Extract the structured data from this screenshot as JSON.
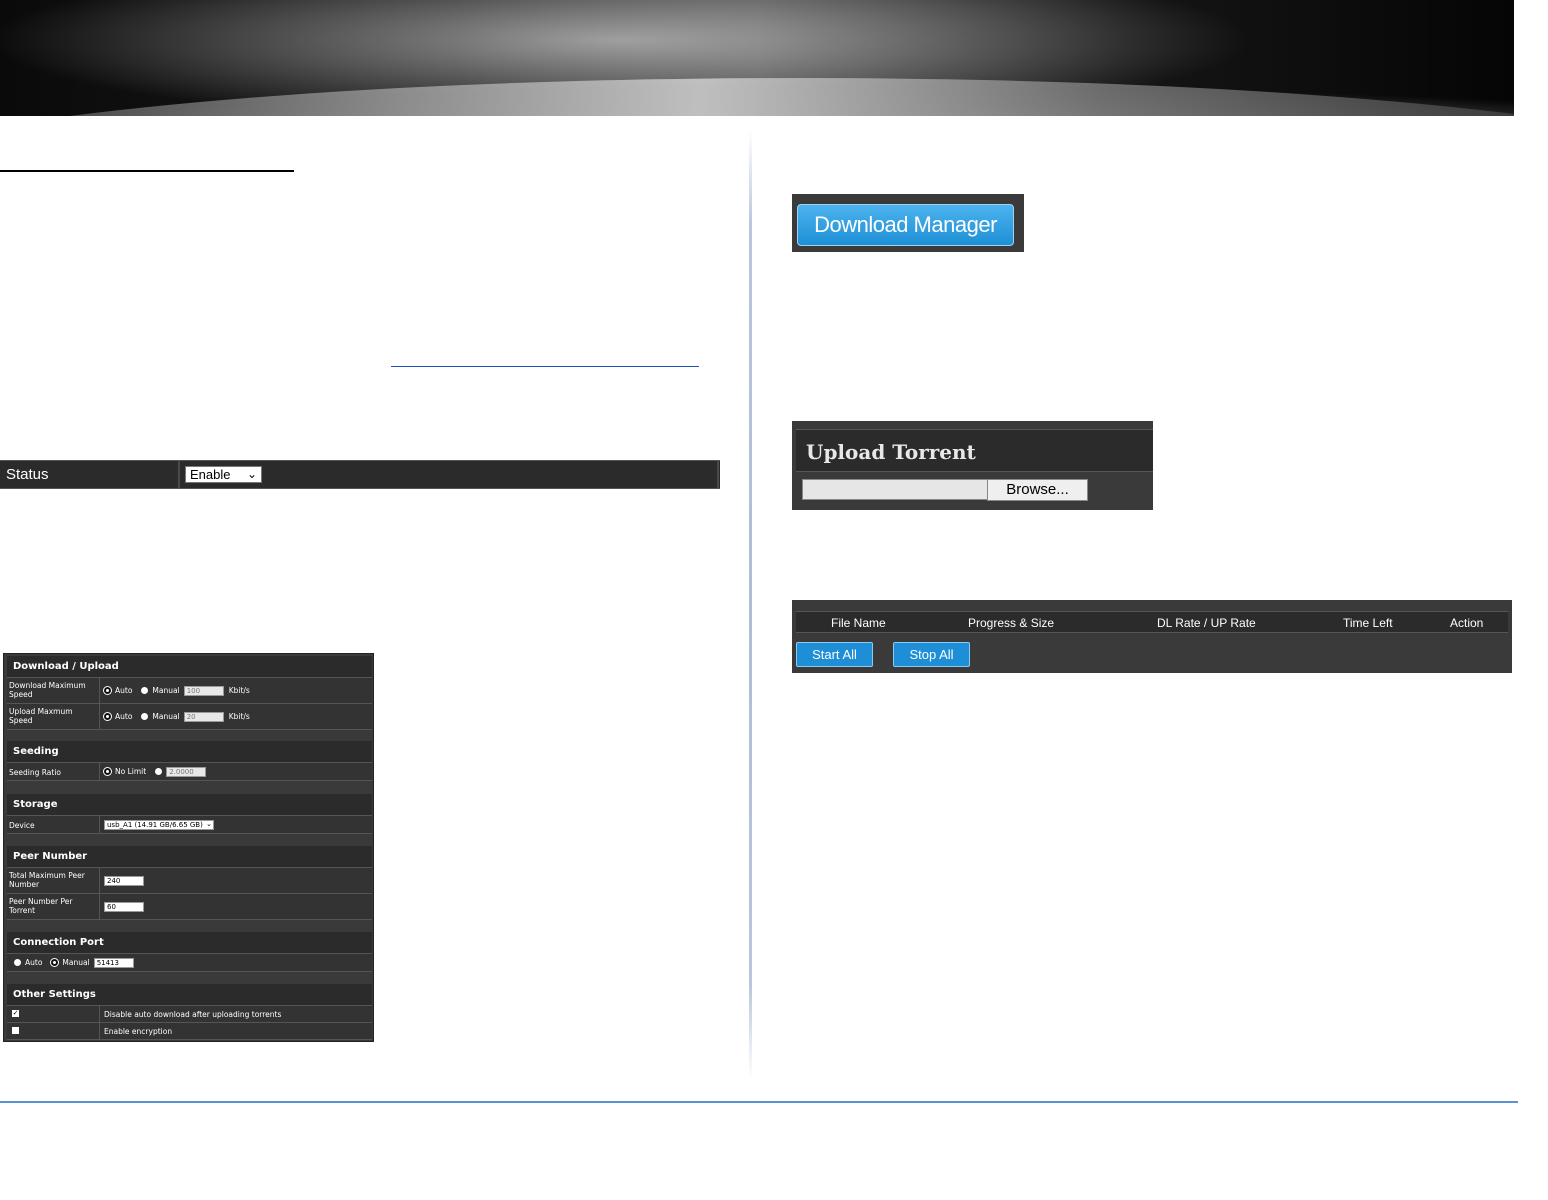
{
  "status": {
    "label": "Status",
    "select_value": "Enable"
  },
  "settings": {
    "download_upload": {
      "heading": "Download / Upload",
      "download_label": "Download Maximum Speed",
      "upload_label": "Upload Maxmum Speed",
      "auto": "Auto",
      "manual": "Manual",
      "download_value": "100",
      "upload_value": "20",
      "unit": "Kbit/s"
    },
    "seeding": {
      "heading": "Seeding",
      "ratio_label": "Seeding Ratio",
      "no_limit": "No Limit",
      "ratio_value": "2.0000"
    },
    "storage": {
      "heading": "Storage",
      "device_label": "Device",
      "device_value": "usb_A1 (14.91 GB/6.65 GB)"
    },
    "peer": {
      "heading": "Peer Number",
      "total_label": "Total Maximum Peer Number",
      "total_value": "240",
      "per_torrent_label": "Peer Number Per Torrent",
      "per_torrent_value": "60"
    },
    "port": {
      "heading": "Connection Port",
      "auto": "Auto",
      "manual": "Manual",
      "value": "51413"
    },
    "other": {
      "heading": "Other Settings",
      "disable_auto": "Disable auto download after uploading torrents",
      "encryption": "Enable encryption"
    }
  },
  "download_manager": {
    "label": "Download Manager"
  },
  "upload_torrent": {
    "heading": "Upload Torrent",
    "browse_label": "Browse..."
  },
  "torrent_list": {
    "columns": [
      "File Name",
      "Progress & Size",
      "DL Rate / UP Rate",
      "Time Left",
      "Action"
    ],
    "start_all": "Start All",
    "stop_all": "Stop All"
  }
}
